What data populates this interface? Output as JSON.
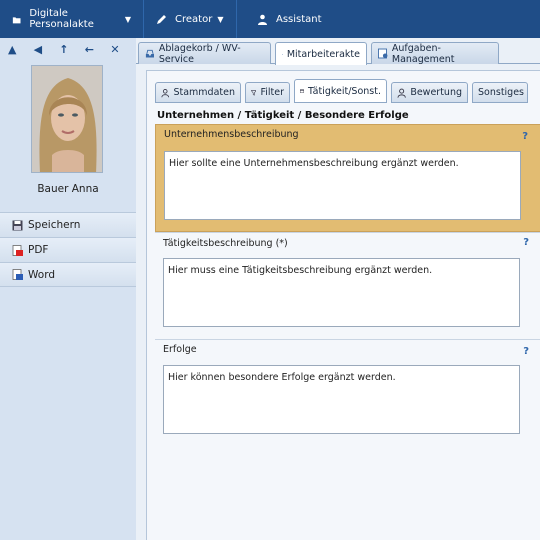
{
  "topbar": {
    "items": [
      {
        "label": "Digitale Personalakte",
        "icon": "folder-icon",
        "dropdown": true
      },
      {
        "label": "Creator",
        "icon": "edit-icon",
        "dropdown": true
      },
      {
        "label": "Assistant",
        "icon": "person-icon",
        "dropdown": false
      }
    ]
  },
  "sidebar": {
    "nav_arrows": [
      "▲",
      "◀",
      "↑",
      "←",
      "✕"
    ],
    "person_name": "Bauer Anna",
    "actions": [
      {
        "label": "Speichern",
        "icon": "save-icon"
      },
      {
        "label": "PDF",
        "icon": "pdf-icon"
      },
      {
        "label": "Word",
        "icon": "word-icon"
      }
    ]
  },
  "outer_tabs": [
    {
      "label": "Ablagekorb / WV-Service",
      "icon": "inbox-icon"
    },
    {
      "label": "Mitarbeiterakte",
      "icon": "file-icon",
      "active": true
    },
    {
      "label": "Aufgaben-Management",
      "icon": "tasks-icon"
    }
  ],
  "inner_tabs": [
    {
      "label": "Stammdaten",
      "icon": "user-icon"
    },
    {
      "label": "Filter",
      "icon": "filter-icon"
    },
    {
      "label": "Tätigkeit/Sonst.",
      "icon": "calendar-icon",
      "active": true
    },
    {
      "label": "Bewertung",
      "icon": "user-icon"
    },
    {
      "label": "Sonstiges",
      "icon": ""
    }
  ],
  "section_title": "Unternehmen / Tätigkeit / Besondere Erfolge",
  "fields": [
    {
      "label": "Unternehmensbeschreibung",
      "value": "Hier sollte eine Unternehmensbeschreibung ergänzt werden.",
      "help": "?"
    },
    {
      "label": "Tätigkeitsbeschreibung (*)",
      "value": "Hier muss eine Tätigkeitsbeschreibung ergänzt werden.",
      "help": "?"
    },
    {
      "label": "Erfolge",
      "value": "Hier können besondere Erfolge ergänzt werden.",
      "help": "?"
    }
  ],
  "colors": {
    "topbar": "#1f4d87",
    "highlight": "#e2bc72",
    "accent": "#2f67ab"
  }
}
